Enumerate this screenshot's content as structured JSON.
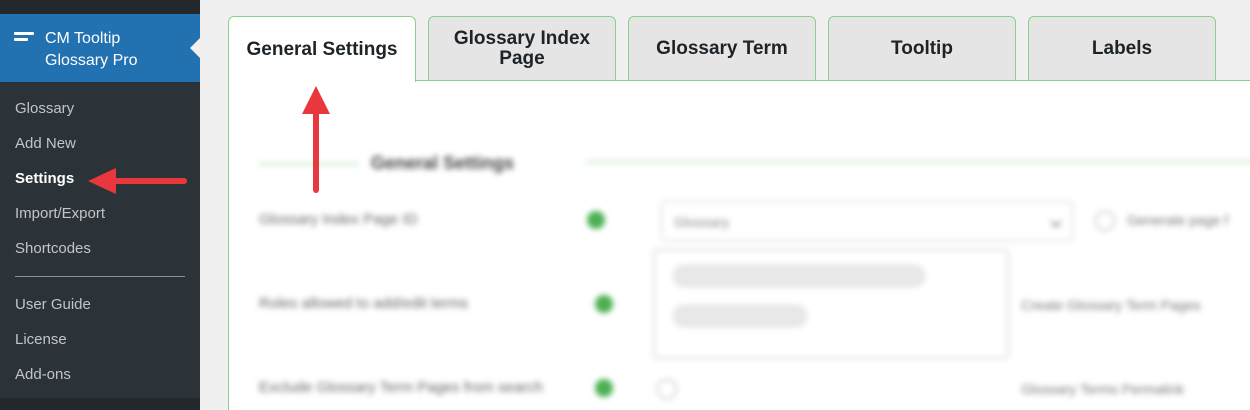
{
  "sidebar": {
    "plugin_title": "CM Tooltip Glossary Pro",
    "items": [
      {
        "label": "Glossary"
      },
      {
        "label": "Add New"
      },
      {
        "label": "Settings",
        "current": true
      },
      {
        "label": "Import/Export"
      },
      {
        "label": "Shortcodes"
      }
    ],
    "items_secondary": [
      {
        "label": "User Guide"
      },
      {
        "label": "License"
      },
      {
        "label": "Add-ons"
      }
    ]
  },
  "tabs": [
    {
      "label": "General Settings",
      "active": true
    },
    {
      "label": "Glossary Index Page"
    },
    {
      "label": "Glossary Term"
    },
    {
      "label": "Tooltip"
    },
    {
      "label": "Labels"
    }
  ],
  "panel": {
    "section_title": "General Settings",
    "rows": [
      {
        "label": "Glossary Index Page ID"
      },
      {
        "label": "Roles allowed to add/edit terms"
      },
      {
        "label": "Exclude Glossary Term Pages from search"
      }
    ],
    "index_page_select_value": "Glossary",
    "generate_page_text": "Generate page f",
    "create_term_pages_text": "Create Glossary Term Pages",
    "term_permalink_text": "Glossary Terms Permalink"
  },
  "colors": {
    "sidebar_bg": "#2c3338",
    "active_menu_bg": "#2271b1",
    "tab_border": "#8ccf8c",
    "annotation_arrow": "#e8383d"
  }
}
